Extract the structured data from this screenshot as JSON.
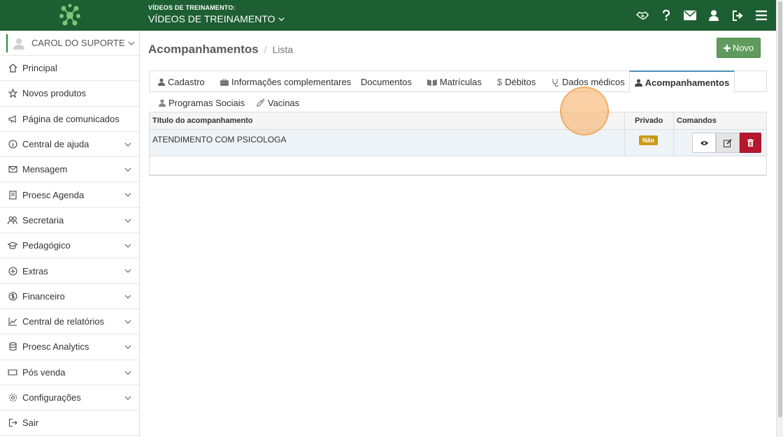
{
  "header": {
    "school_label": "VÍDEOS DE TREINAMENTO:",
    "school_name": "VÍDEOS DE TREINAMENTO"
  },
  "colors": {
    "brand_green": "#1d5e32",
    "new_button": "#5e9b5c",
    "badge": "#c99a18",
    "delete": "#b5172f",
    "active_tab_accent": "#4a8fb8"
  },
  "sidebar": {
    "user": "CAROL DO SUPORTE",
    "items": [
      {
        "label": "Principal",
        "icon": "home-icon",
        "expandable": false
      },
      {
        "label": "Novos produtos",
        "icon": "star-icon",
        "expandable": false
      },
      {
        "label": "Página de comunicados",
        "icon": "megaphone-icon",
        "expandable": false
      },
      {
        "label": "Central de ajuda",
        "icon": "info-icon",
        "expandable": true
      },
      {
        "label": "Mensagem",
        "icon": "envelope-icon",
        "expandable": true
      },
      {
        "label": "Proesc Agenda",
        "icon": "agenda-icon",
        "expandable": true
      },
      {
        "label": "Secretaria",
        "icon": "users-icon",
        "expandable": true
      },
      {
        "label": "Pedagógico",
        "icon": "graduation-cap-icon",
        "expandable": true
      },
      {
        "label": "Extras",
        "icon": "plus-circle-icon",
        "expandable": true
      },
      {
        "label": "Financeiro",
        "icon": "dollar-circle-icon",
        "expandable": true
      },
      {
        "label": "Central de relatórios",
        "icon": "line-chart-icon",
        "expandable": true
      },
      {
        "label": "Proesc Analytics",
        "icon": "database-icon",
        "expandable": true
      },
      {
        "label": "Pós venda",
        "icon": "ticket-icon",
        "expandable": true
      },
      {
        "label": "Configurações",
        "icon": "gear-icon",
        "expandable": true
      },
      {
        "label": "Sair",
        "icon": "logout-icon",
        "expandable": false
      }
    ]
  },
  "breadcrumb": {
    "title": "Acompanhamentos",
    "separator": "/",
    "current": "Lista"
  },
  "new_button": "Novo",
  "tabs": {
    "cadastro": "Cadastro",
    "info": "Informações complementares",
    "documentos": "Documentos",
    "matriculas": "Matrículas",
    "debitos": "Débitos",
    "dados_medicos": "Dados médicos",
    "acompanhamentos": "Acompanhamentos",
    "programas": "Programas Sociais",
    "vacinas": "Vacinas"
  },
  "table": {
    "headers": {
      "title": "Título do acompanhamento",
      "private": "Privado",
      "commands": "Comandos"
    },
    "rows": [
      {
        "title": "ATENDIMENTO COM PSICOLOGA",
        "private": "Não"
      }
    ]
  }
}
